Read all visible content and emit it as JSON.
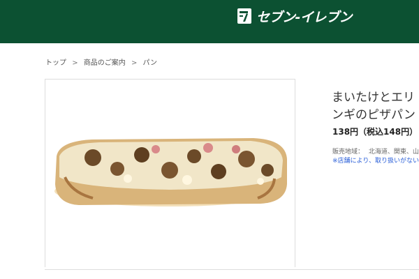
{
  "header": {
    "brand_name": "セブン-イレブン",
    "logo_icon": "seven-eleven-logo",
    "colors": {
      "header_bg": "#0c5132",
      "text": "#ffffff"
    }
  },
  "breadcrumb": {
    "items": [
      "トップ",
      "商品のご案内",
      "パン"
    ],
    "separator": ">"
  },
  "product": {
    "title": "まいたけとエリンギのピザパン",
    "price": "138円（税込148円）",
    "area_label": "販売地域：",
    "area_value": "北海道、関東、山",
    "note": "※店舗により、取り扱いがない場合があります。",
    "image_icon": "pizza-bread-product-photo"
  },
  "colors": {
    "link_blue": "#2a5fd8",
    "border": "#dddddd"
  }
}
